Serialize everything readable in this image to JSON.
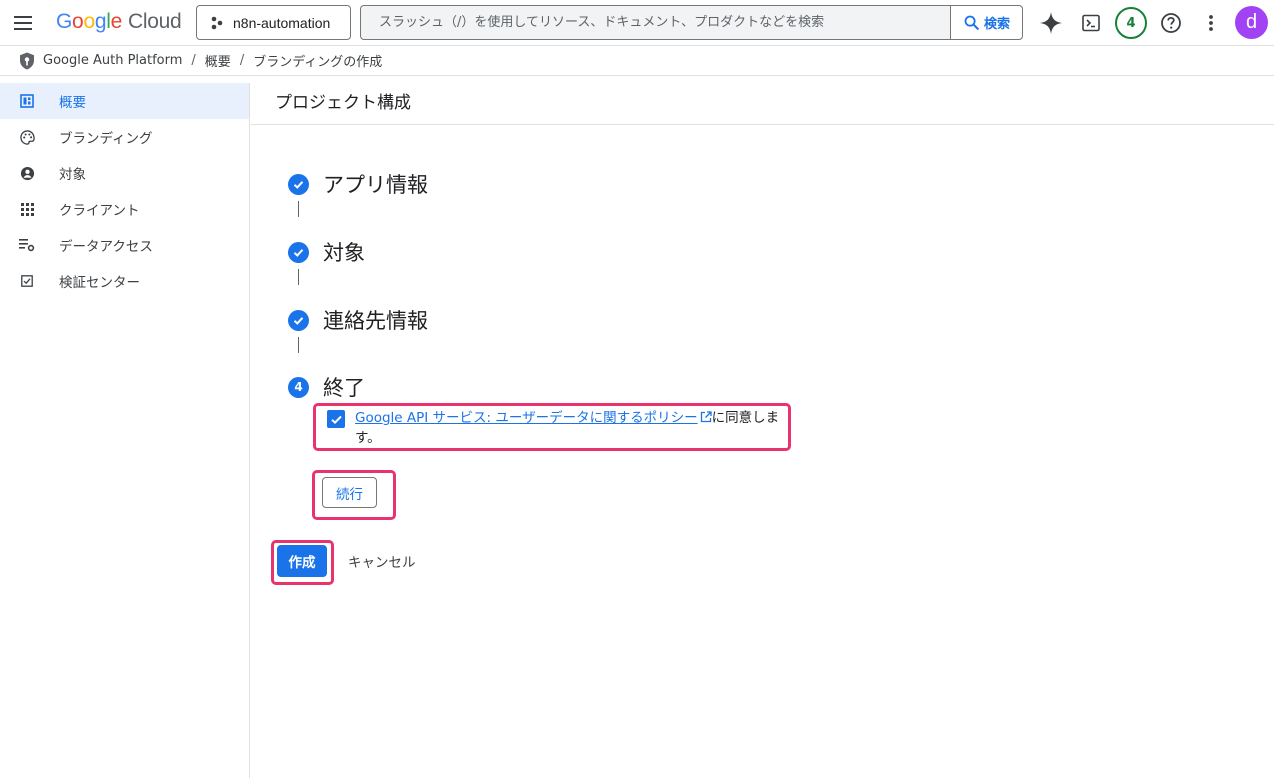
{
  "header": {
    "logo_google": [
      "G",
      "o",
      "o",
      "g",
      "l",
      "e"
    ],
    "logo_cloud": "Cloud",
    "project_name": "n8n-automation",
    "search_placeholder": "スラッシュ（/）を使用してリソース、ドキュメント、プロダクトなどを検索",
    "search_button": "検索",
    "notification_count": "4",
    "avatar_letter": "d"
  },
  "breadcrumb": {
    "items": [
      "Google Auth Platform",
      "概要",
      "ブランディングの作成"
    ],
    "separator": "/"
  },
  "sidebar": {
    "items": [
      {
        "label": "概要",
        "icon": "dashboard-icon",
        "active": true
      },
      {
        "label": "ブランディング",
        "icon": "palette-icon",
        "active": false
      },
      {
        "label": "対象",
        "icon": "person-icon",
        "active": false
      },
      {
        "label": "クライアント",
        "icon": "grid-icon",
        "active": false
      },
      {
        "label": "データアクセス",
        "icon": "settings-list-icon",
        "active": false
      },
      {
        "label": "検証センター",
        "icon": "check-box-icon",
        "active": false
      }
    ]
  },
  "main": {
    "title": "プロジェクト構成",
    "steps": [
      {
        "label": "アプリ情報",
        "status": "complete"
      },
      {
        "label": "対象",
        "status": "complete"
      },
      {
        "label": "連絡先情報",
        "status": "complete"
      },
      {
        "label": "終了",
        "status": "current",
        "number": "4"
      }
    ],
    "agreement": {
      "checked": true,
      "link_text": "Google API サービス: ユーザーデータに関するポリシー",
      "suffix": "に同意します。"
    },
    "continue_label": "続行",
    "create_label": "作成",
    "cancel_label": "キャンセル"
  },
  "colors": {
    "accent": "#1a73e8",
    "highlight": "#e8336d",
    "badge": "#188038",
    "avatar": "#a142f4"
  }
}
